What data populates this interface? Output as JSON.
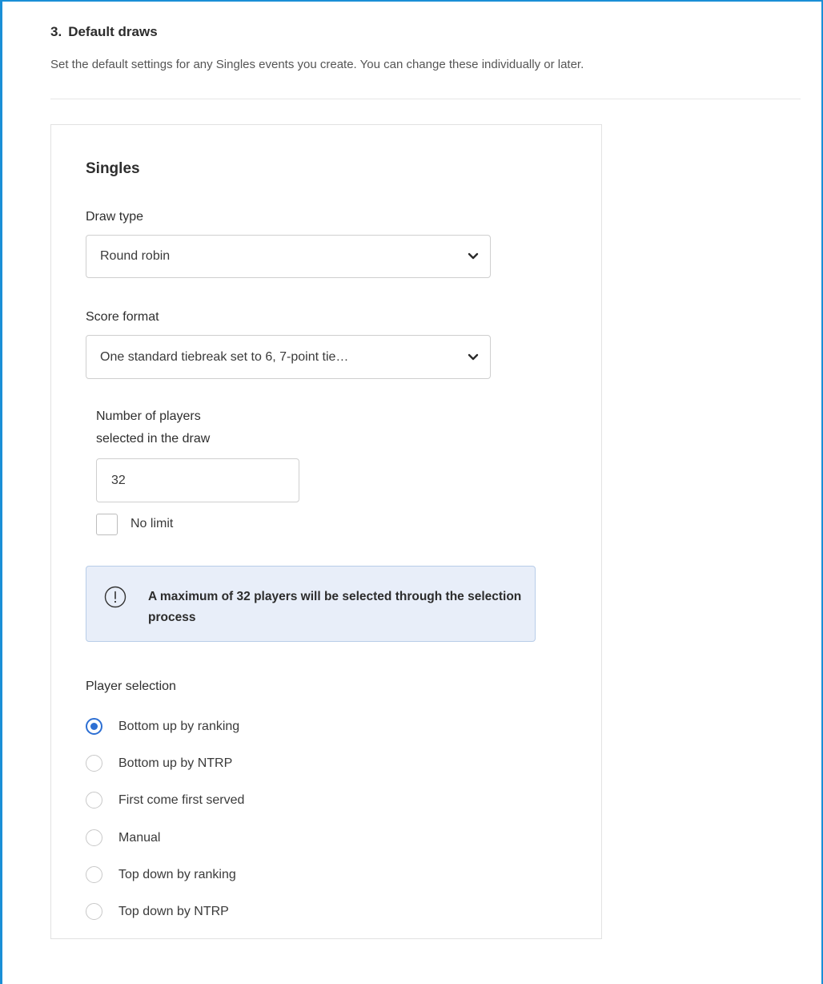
{
  "section": {
    "number": "3.",
    "title": "Default draws",
    "description": "Set the default settings for any Singles events you create. You can change these individually or later."
  },
  "singles": {
    "title": "Singles",
    "draw_type": {
      "label": "Draw type",
      "value": "Round robin"
    },
    "score_format": {
      "label": "Score format",
      "value": "One standard tiebreak set to 6, 7-point tie…"
    },
    "players": {
      "label_line1": "Number of players",
      "label_line2": "selected in the draw",
      "value": "32",
      "no_limit_label": "No limit",
      "no_limit_checked": false
    },
    "info": {
      "icon": "info-icon",
      "text": "A maximum of 32 players will be selected through the selection process"
    },
    "player_selection": {
      "label": "Player selection",
      "selected": "Bottom up by ranking",
      "options": [
        "Bottom up by ranking",
        "Bottom up by NTRP",
        "First come first served",
        "Manual",
        "Top down by ranking",
        "Top down by NTRP"
      ]
    }
  },
  "colors": {
    "frame_border": "#1a8fd6",
    "accent": "#2d6fd3",
    "info_background": "#e8eef9"
  }
}
